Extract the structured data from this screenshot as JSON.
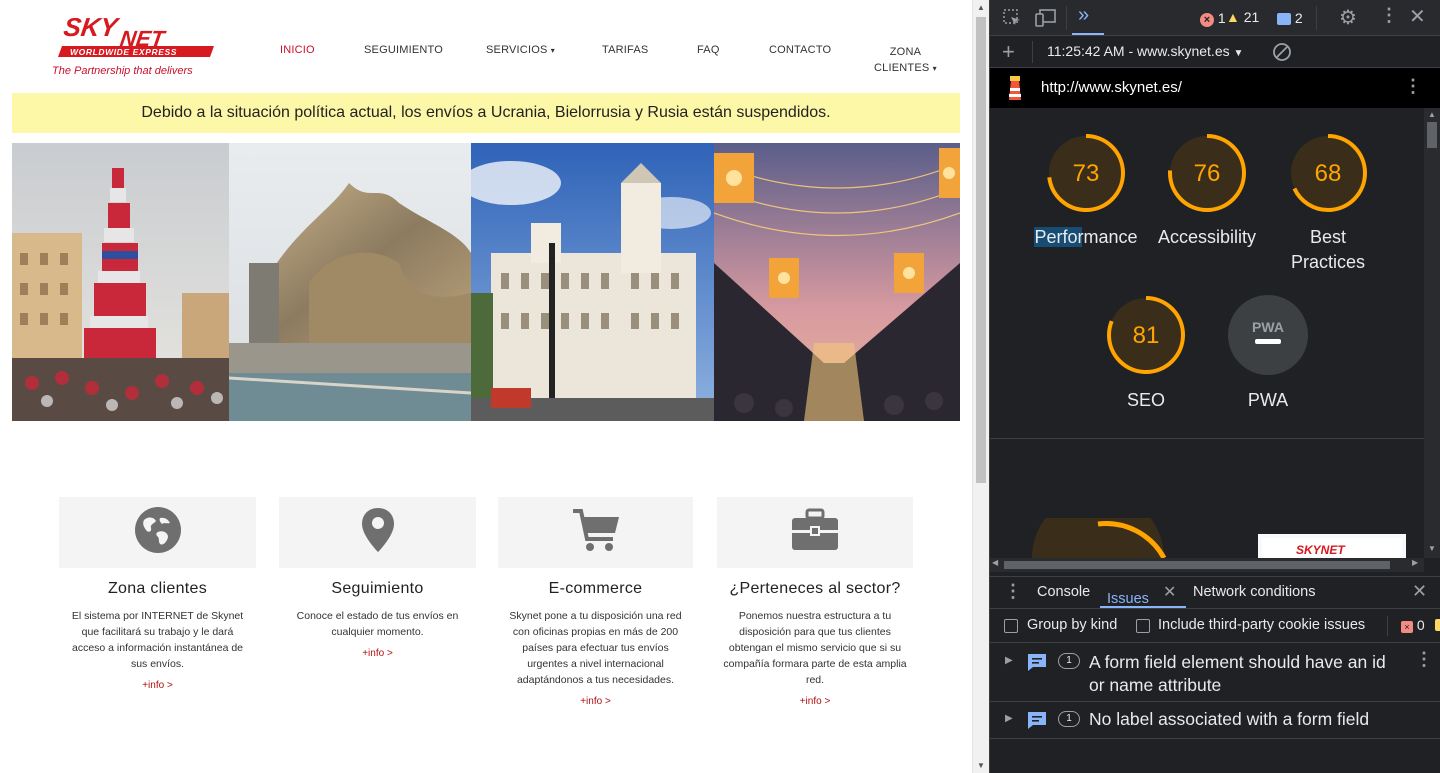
{
  "site": {
    "logo": {
      "name": "SKYNET",
      "tagline_box": "WORLDWIDE EXPRESS",
      "slogan": "The Partnership that delivers"
    },
    "nav": [
      {
        "label": "INICIO",
        "active": true
      },
      {
        "label": "SEGUIMIENTO"
      },
      {
        "label": "SERVICIOS",
        "dropdown": true
      },
      {
        "label": "TARIFAS"
      },
      {
        "label": "FAQ"
      },
      {
        "label": "CONTACTO"
      },
      {
        "label": "ZONA",
        "label2": "CLIENTES",
        "dropdown": true
      }
    ],
    "banner": "Debido a la situación política actual, los envíos a Ucrania, Bielorrusia y Rusia están suspendidos.",
    "cards": [
      {
        "icon": "globe-icon",
        "title": "Zona clientes",
        "text": "El sistema por INTERNET de Skynet que facilitará su trabajo y le dará acceso a información instantánea de sus envíos.",
        "link": "+info >"
      },
      {
        "icon": "map-pin-icon",
        "title": "Seguimiento",
        "text": "Conoce el estado de tus envíos en cualquier momento.",
        "link": "+info >"
      },
      {
        "icon": "shopping-cart-icon",
        "title": "E-commerce",
        "text": "Skynet pone a tu disposición una red con oficinas propias en más de 200 países para efectuar tus envíos urgentes a nivel internacional adaptándonos a tus necesidades.",
        "link": "+info >"
      },
      {
        "icon": "briefcase-icon",
        "title": "¿Perteneces al sector?",
        "text": "Ponemos nuestra estructura a tu disposición para que tus clientes obtengan el mismo servicio que si su compañía formara parte de esta amplia red.",
        "link": "+info >"
      }
    ]
  },
  "devtools": {
    "toolbar": {
      "errors": "1",
      "warnings": "21",
      "messages": "2"
    },
    "report_selector": "11:25:42 AM - www.skynet.es",
    "url": "http://www.skynet.es/",
    "scores": [
      {
        "label": "Performance",
        "score": 73
      },
      {
        "label": "Accessibility",
        "score": 76
      },
      {
        "label": "Best",
        "label2": "Practices",
        "score": 68
      },
      {
        "label": "SEO",
        "score": 81
      },
      {
        "label": "PWA",
        "score": null,
        "badge": "PWA"
      }
    ],
    "drawer": {
      "tabs": [
        "Console",
        "Issues",
        "Network conditions"
      ],
      "active_tab": "Issues",
      "group_by_kind": "Group by kind",
      "third_party": "Include third-party cookie issues",
      "issue_count": "0",
      "issues": [
        {
          "count": "1",
          "text": "A form field element should have an id",
          "text2": "or name attribute"
        },
        {
          "count": "1",
          "text": "No label associated with a form field"
        }
      ]
    },
    "colors": {
      "gauge": "#ffa400",
      "gauge_bg": "#3a2e1a",
      "link_blue": "#8ab4f8"
    }
  }
}
